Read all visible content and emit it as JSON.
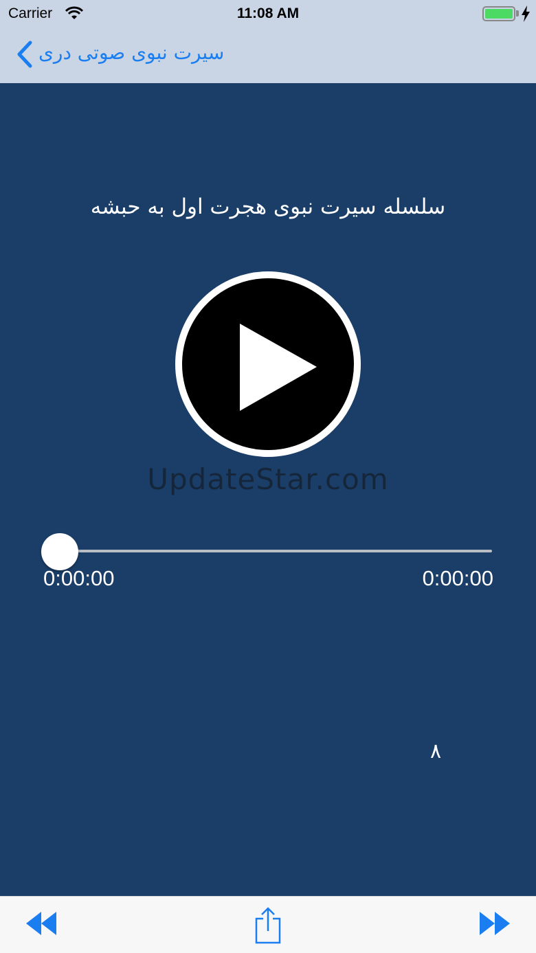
{
  "status_bar": {
    "carrier": "Carrier",
    "time": "11:08 AM"
  },
  "nav": {
    "back_title": "سیرت نبوی صوتی دری"
  },
  "player": {
    "track_title": "سلسله سیرت نبوی هجرت اول به حبشه",
    "watermark": "UpdateStar.com",
    "elapsed": "0:00:00",
    "duration": "0:00:00",
    "progress": 0,
    "track_number": "۸"
  },
  "toolbar": {
    "icons": [
      "rewind-icon",
      "share-icon",
      "fast-forward-icon"
    ]
  },
  "colors": {
    "background": "#1b3e69",
    "nav_background": "#c9d4e4",
    "accent": "#1a7ef0",
    "toolbar_background": "#f7f7f8"
  }
}
